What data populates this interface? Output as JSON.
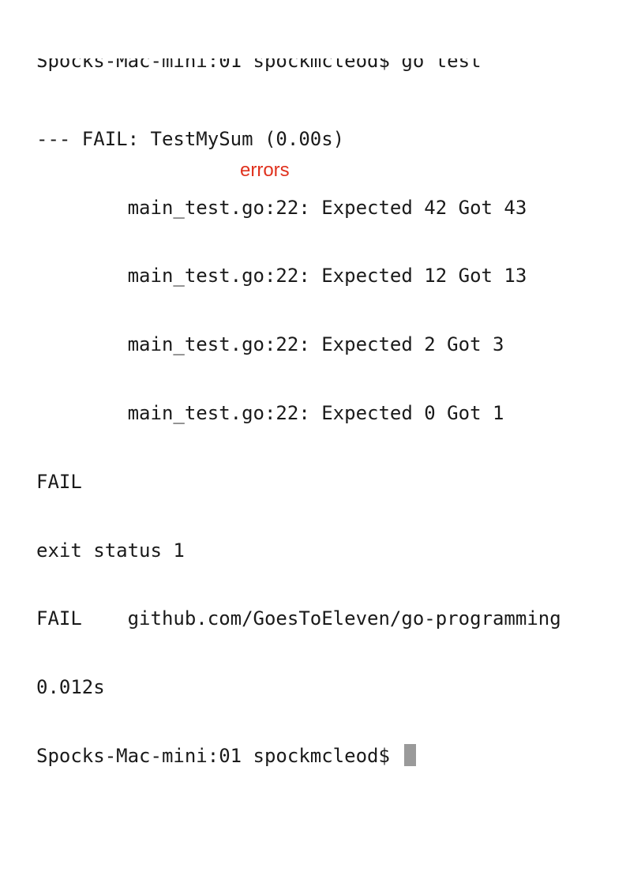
{
  "terminal": {
    "lines": [
      "Spocks-Mac-mini:01 spockmcleod$ go test",
      "--- FAIL: TestMySum (0.00s)",
      "        main_test.go:22: Expected 42 Got 43",
      "        main_test.go:22: Expected 12 Got 13",
      "        main_test.go:22: Expected 2 Got 3",
      "        main_test.go:22: Expected 0 Got 1",
      "FAIL",
      "exit status 1",
      "FAIL    github.com/GoesToEleven/go-programming",
      "0.012s",
      "Spocks-Mac-mini:01 spockmcleod$"
    ],
    "annotation": "errors",
    "annotation_color": "#e0321e",
    "cursor_color": "#9a9a9a"
  }
}
